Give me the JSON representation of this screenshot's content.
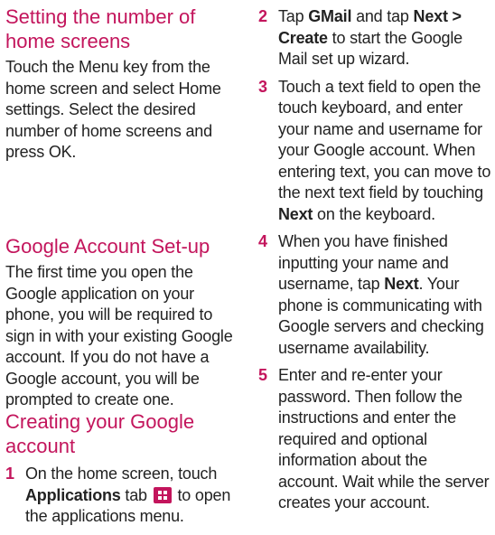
{
  "sections": {
    "home_screens": {
      "heading": "Setting the number of home screens",
      "body": "Touch the Menu key from the home screen and select Home settings. Select the desired number of home screens and press OK."
    },
    "google_account": {
      "heading": "Google Account Set-up",
      "body": "The first time you open the Google application on your phone, you will be required to sign in with your existing Google account. If you do not have a Google account, you will be prompted to create one."
    },
    "create_account": {
      "heading": "Creating your Google account",
      "step1": {
        "number": "1",
        "text_a": "On the home screen, touch",
        "bold_a": "Applications",
        "text_b": "tab",
        "text_c": "to open the applications menu."
      }
    }
  },
  "steps": {
    "step2": {
      "number": "2",
      "text_a": "Tap",
      "bold_a": "GMail",
      "text_b": "and tap",
      "bold_b": "Next >",
      "bold_c": "Create",
      "text_c": "to start the Google Mail set up wizard."
    },
    "step3": {
      "number": "3",
      "text_a": "Touch a text field to open the touch keyboard, and enter your name and username for your Google account. When entering text, you can move to the next text field by touching",
      "bold_a": "Next",
      "text_b": "on the keyboard."
    },
    "step4": {
      "number": "4",
      "text_a": "When you have finished inputting your name and username, tap",
      "bold_a": "Next",
      "text_b": ". Your phone is communicating with Google servers and checking username availability."
    },
    "step5": {
      "number": "5",
      "text_a": "Enter and re-enter your password. Then follow the instructions and enter the required and optional information about the account. Wait while the server creates your account."
    }
  },
  "icons": {
    "applications_tab_icon": "applications-grid-icon",
    "accent_color": "#c3155c"
  }
}
